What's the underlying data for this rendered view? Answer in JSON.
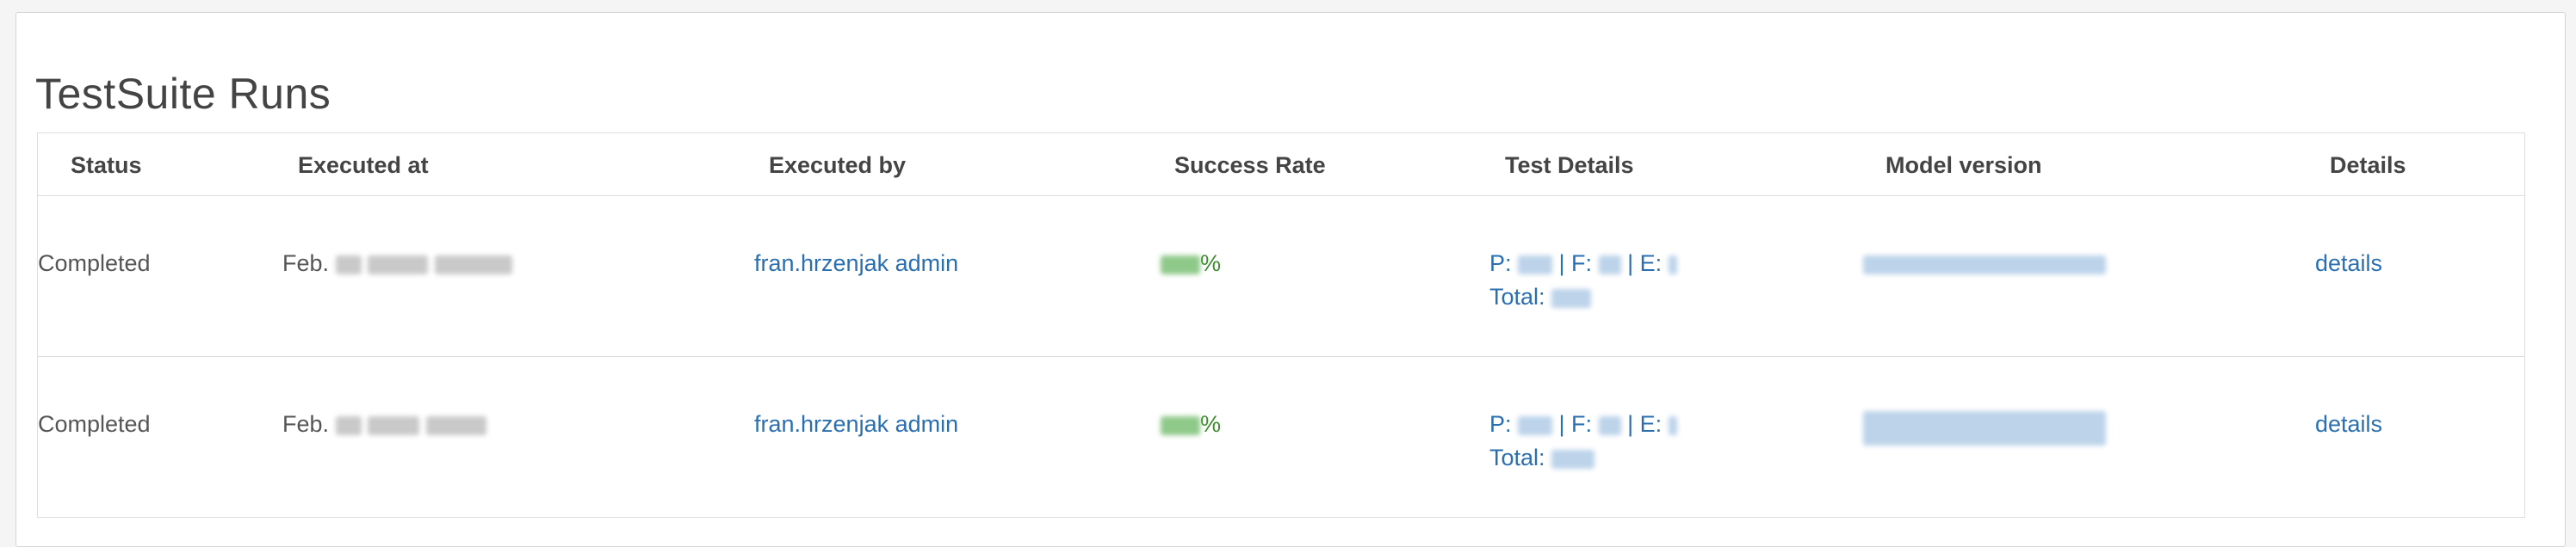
{
  "page": {
    "title": "TestSuite Runs"
  },
  "table": {
    "headers": {
      "status": "Status",
      "executed_at": "Executed at",
      "executed_by": "Executed by",
      "success_rate": "Success Rate",
      "test_details": "Test Details",
      "model_version": "Model version",
      "details": "Details"
    },
    "rows": [
      {
        "status": "Completed",
        "executed_at_prefix": "Feb.",
        "executed_by": "fran.hrzenjak admin",
        "success_rate_suffix": "%",
        "passed_label": "P:",
        "failed_label": "| F:",
        "errors_label": "| E:",
        "total_label": "Total:",
        "details_link": "details"
      },
      {
        "status": "Completed",
        "executed_at_prefix": "Feb.",
        "executed_by": "fran.hrzenjak admin",
        "success_rate_suffix": "%",
        "passed_label": "P:",
        "failed_label": "| F:",
        "errors_label": "| E:",
        "total_label": "Total:",
        "details_link": "details"
      }
    ]
  },
  "colors": {
    "link": "#2a6fb0",
    "success": "#3c8c2e",
    "text": "#555555"
  }
}
